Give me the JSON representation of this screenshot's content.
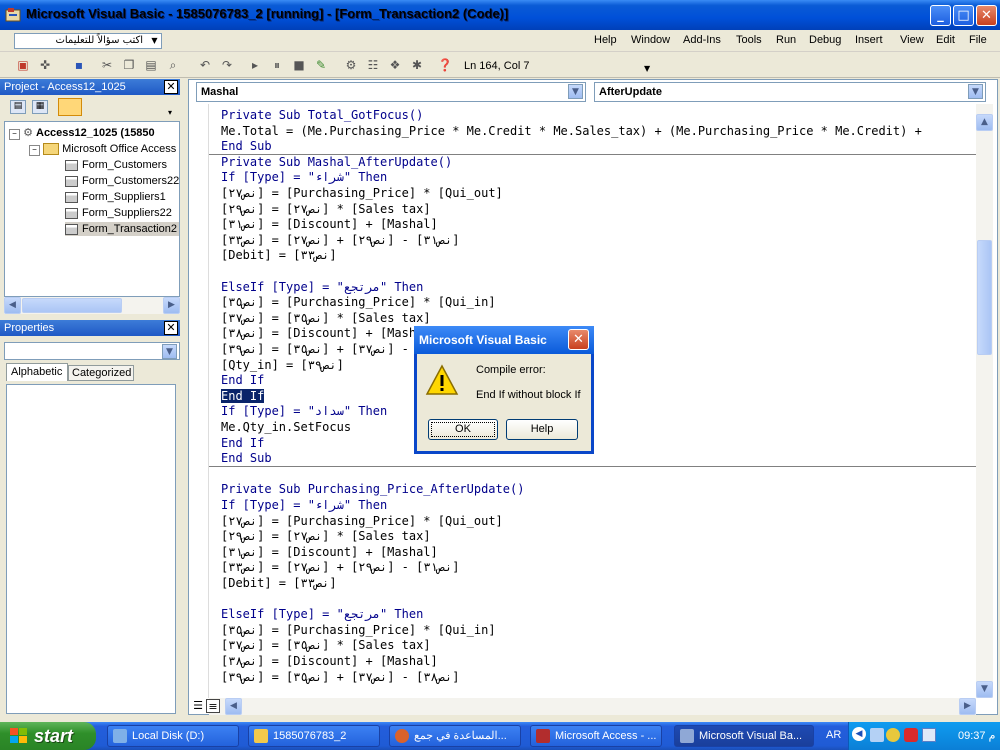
{
  "window": {
    "title": "Microsoft Visual Basic - 1585076783_2 [running] - [Form_Transaction2 (Code)]",
    "minimize": "_",
    "maximize": "□",
    "close": "✕"
  },
  "menubar": {
    "help_placeholder": "اكتب سؤالاً للتعليمات",
    "items": [
      "Help",
      "Window",
      "Add-Ins",
      "Tools",
      "Run",
      "Debug",
      "Insert",
      "View",
      "Edit",
      "File"
    ]
  },
  "toolbar": {
    "position": "Ln 164, Col 7"
  },
  "project": {
    "title": "Project - Access12_1025",
    "root": "Access12_1025 (15850",
    "folder": "Microsoft Office Access",
    "forms": [
      "Form_Customers",
      "Form_Customers22",
      "Form_Suppliers1",
      "Form_Suppliers22",
      "Form_Transaction2"
    ],
    "selected_index": 4
  },
  "properties": {
    "title": "Properties",
    "tabs": [
      "Alphabetic",
      "Categorized"
    ]
  },
  "code": {
    "object_combo": "Mashal",
    "procedure_combo": "AfterUpdate",
    "lines": [
      {
        "t": "Private Sub Total_GotFocus()",
        "k": true
      },
      {
        "t": "Me.Total = (Me.Purchasing_Price * Me.Credit * Me.Sales_tax) + (Me.Purchasing_Price * Me.Credit) +"
      },
      {
        "t": "End Sub",
        "k": true,
        "sep": true
      },
      {
        "t": "Private Sub Mashal_AfterUpdate()",
        "k": true
      },
      {
        "t": "If [Type] = \"شراء\" Then",
        "k": true
      },
      {
        "t": "[نص٢٧] = [Purchasing_Price] * [Qui_out]"
      },
      {
        "t": "[نص٢٩] = [نص٢٧] * [Sales tax]"
      },
      {
        "t": "[نص٣١] = [Discount] + [Mashal]"
      },
      {
        "t": "[نص٣٣] = [نص٢٧] + [نص٢٩] - [نص٣١]"
      },
      {
        "t": "[Debit] = [نص٣٣]"
      },
      {
        "t": ""
      },
      {
        "t": "ElseIf [Type] = \"مرتجع\" Then",
        "k": true
      },
      {
        "t": "[نص٣٥] = [Purchasing_Price] * [Qui_in]"
      },
      {
        "t": "[نص٣٧] = [نص٣٥] * [Sales tax]"
      },
      {
        "t": "[نص٣٨] = [Discount] + [Mashal]"
      },
      {
        "t": "[نص٣٩] = [نص٣٥] + [نص٣٧] - [نص٣٨]"
      },
      {
        "t": "[Qty_in] = [نص٣٩]"
      },
      {
        "t": "End If",
        "k": true
      },
      {
        "t": "End If",
        "k": true,
        "sel": true
      },
      {
        "t": "If [Type] = \"سداد\" Then",
        "k": true
      },
      {
        "t": "Me.Qty_in.SetFocus"
      },
      {
        "t": "End If",
        "k": true
      },
      {
        "t": "End Sub",
        "k": true,
        "sep": true
      },
      {
        "t": ""
      },
      {
        "t": "Private Sub Purchasing_Price_AfterUpdate()",
        "k": true
      },
      {
        "t": "If [Type] = \"شراء\" Then",
        "k": true
      },
      {
        "t": "[نص٢٧] = [Purchasing_Price] * [Qui_out]"
      },
      {
        "t": "[نص٢٩] = [نص٢٧] * [Sales tax]"
      },
      {
        "t": "[نص٣١] = [Discount] + [Mashal]"
      },
      {
        "t": "[نص٣٣] = [نص٢٧] + [نص٢٩] - [نص٣١]"
      },
      {
        "t": "[Debit] = [نص٣٣]"
      },
      {
        "t": ""
      },
      {
        "t": "ElseIf [Type] = \"مرتجع\" Then",
        "k": true
      },
      {
        "t": "[نص٣٥] = [Purchasing_Price] * [Qui_in]"
      },
      {
        "t": "[نص٣٧] = [نص٣٥] * [Sales tax]"
      },
      {
        "t": "[نص٣٨] = [Discount] + [Mashal]"
      },
      {
        "t": "[نص٣٩] = [نص٣٥] + [نص٣٧] - [نص٣٨]"
      }
    ]
  },
  "dialog": {
    "title": "Microsoft Visual Basic",
    "line1": "Compile error:",
    "line2": "End If without block If",
    "ok": "OK",
    "help": "Help",
    "icon": "warning-icon"
  },
  "taskbar": {
    "start": "start",
    "tasks": [
      {
        "label": "Local Disk (D:)",
        "color": "#7fb0e8"
      },
      {
        "label": "1585076783_2",
        "color": "#f2c94c"
      },
      {
        "label": "المساعدة في جمع...",
        "color": "#d9622b"
      },
      {
        "label": "Microsoft Access - ...",
        "color": "#b22d2d"
      },
      {
        "label": "Microsoft Visual Ba...",
        "color": "#8fa8d6"
      }
    ],
    "active_index": 4,
    "lang": "AR",
    "clock": "09:37 م"
  }
}
